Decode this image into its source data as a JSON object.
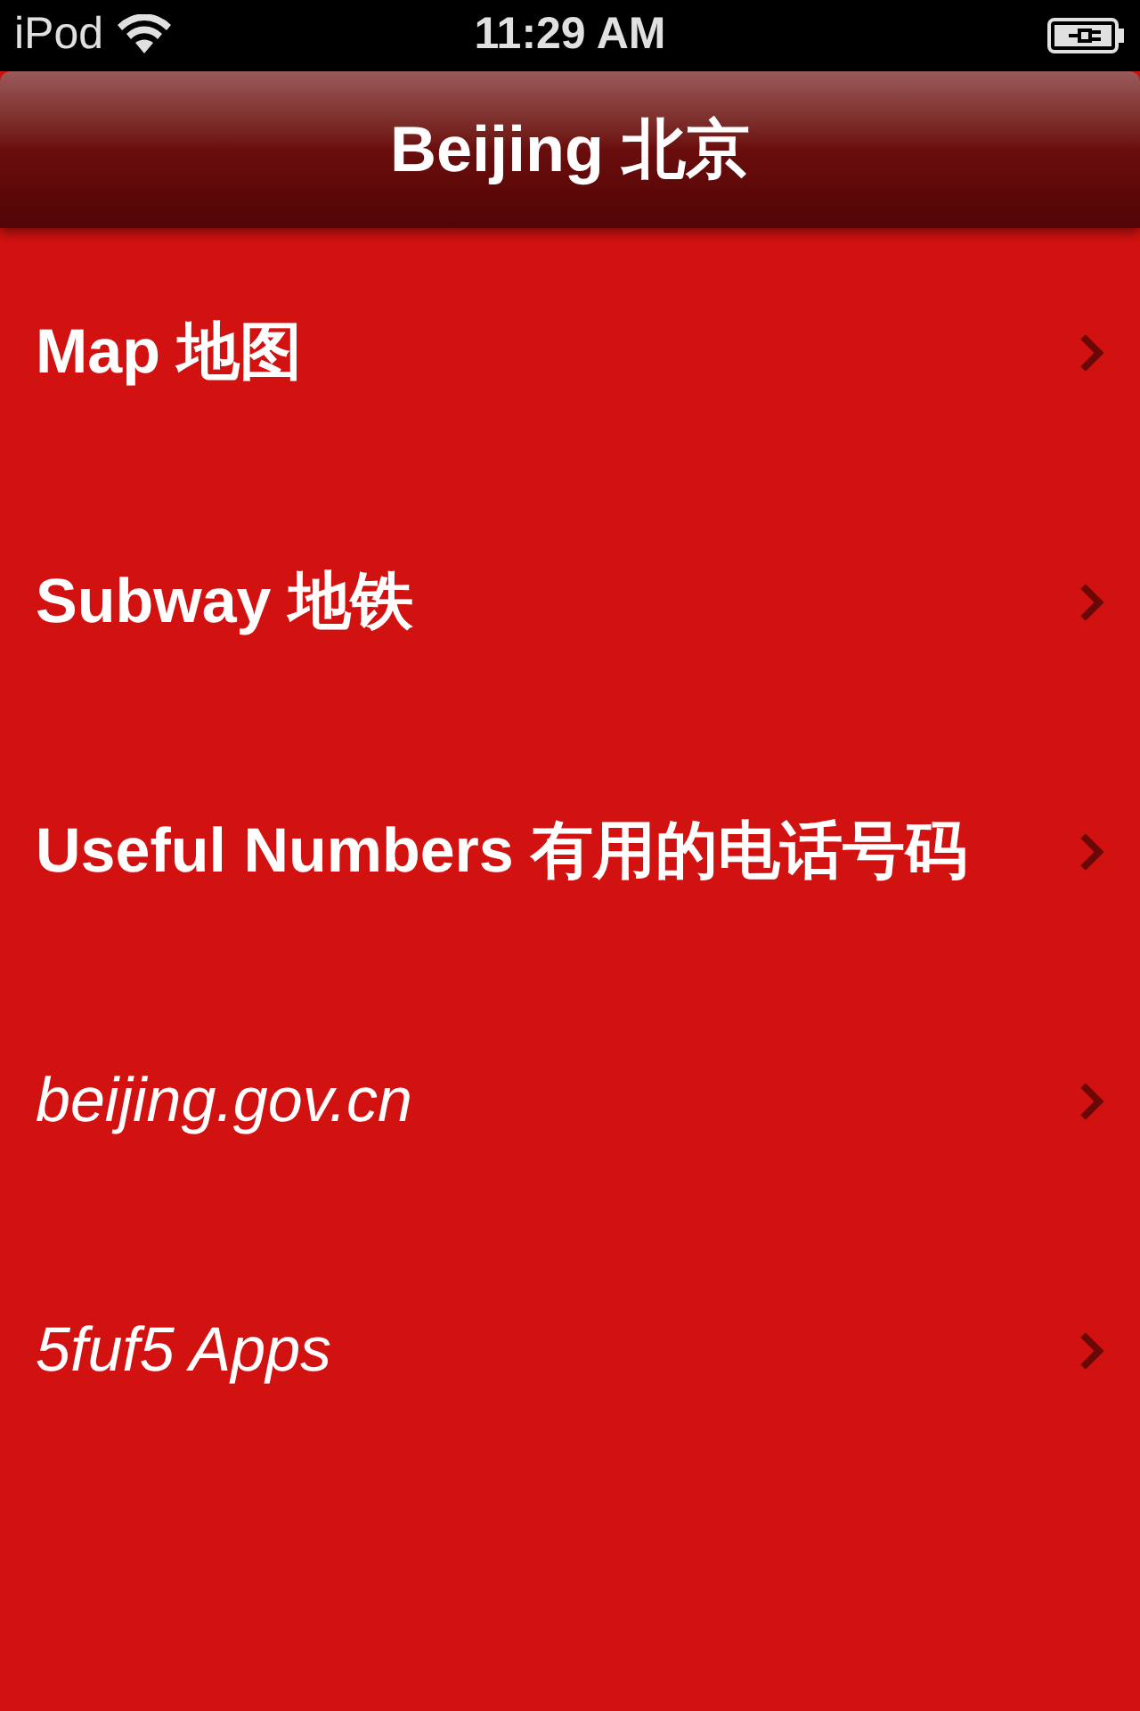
{
  "status_bar": {
    "carrier": "iPod",
    "time": "11:29 AM"
  },
  "nav_bar": {
    "title": "Beijing 北京"
  },
  "items": [
    {
      "label": "Map 地图",
      "kind": "section"
    },
    {
      "label": "Subway 地铁",
      "kind": "section"
    },
    {
      "label": "Useful Numbers 有用的电话号码",
      "kind": "section"
    },
    {
      "label": "beijing.gov.cn",
      "kind": "link"
    },
    {
      "label": "5fuf5 Apps",
      "kind": "link"
    }
  ]
}
